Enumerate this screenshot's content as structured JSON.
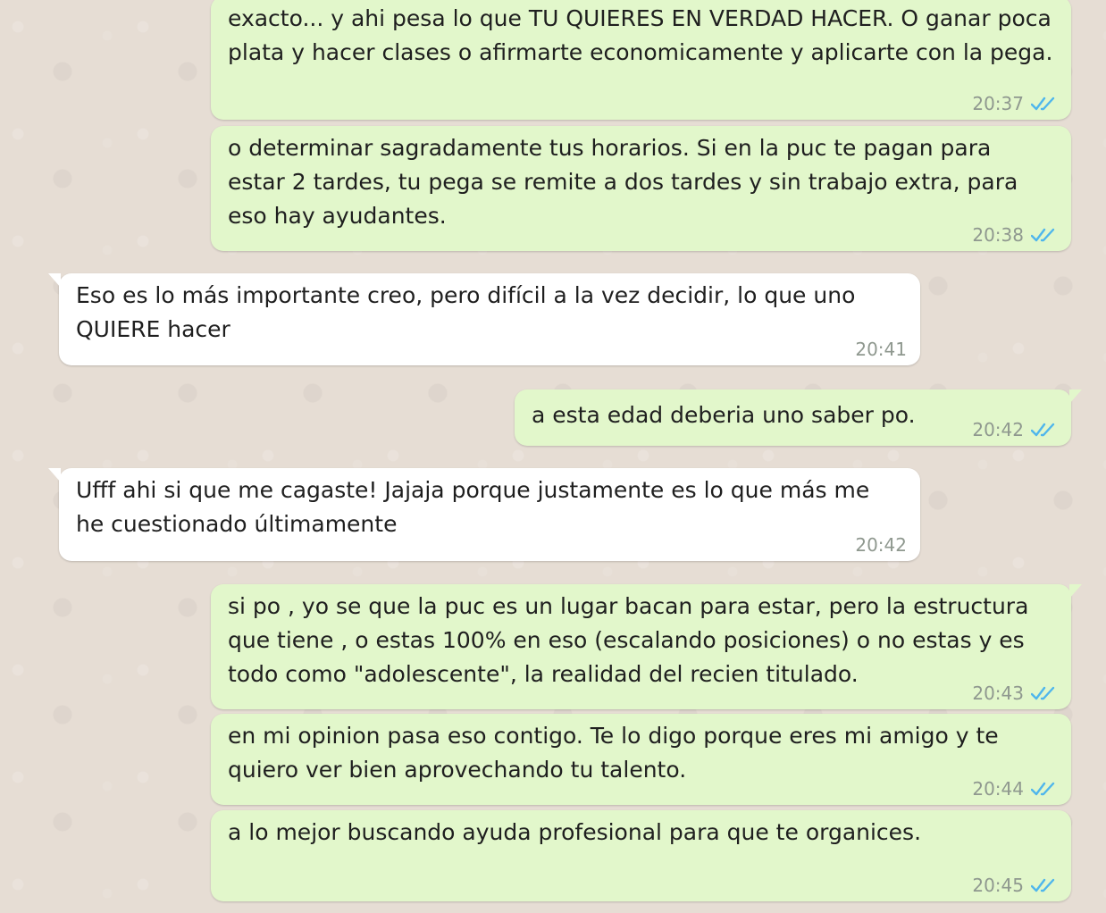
{
  "messages": [
    {
      "direction": "outgoing",
      "text": "exacto... y ahi pesa lo que TU QUIERES EN VERDAD HACER. O ganar poca plata y hacer clases o afirmarte economicamente y aplicarte con la pega.",
      "time": "20:37",
      "status_icon": "double-check-read"
    },
    {
      "direction": "outgoing",
      "text": "o determinar sagradamente tus horarios. Si en la puc te pagan para estar 2 tardes, tu pega se remite a dos tardes y sin trabajo extra, para eso hay ayudantes.",
      "time": "20:38",
      "status_icon": "double-check-read"
    },
    {
      "direction": "incoming",
      "text": "Eso es lo más importante creo, pero difícil a la vez decidir, lo que uno QUIERE hacer",
      "time": "20:41"
    },
    {
      "direction": "outgoing",
      "text": "a esta edad deberia uno saber po.",
      "time": "20:42",
      "status_icon": "double-check-read"
    },
    {
      "direction": "incoming",
      "text": "Ufff ahi si que me cagaste! Jajaja porque justamente es lo que más me he cuestionado últimamente",
      "time": "20:42"
    },
    {
      "direction": "outgoing",
      "text": "si po , yo se que la puc es un lugar bacan para estar, pero la estructura que tiene , o estas 100% en eso (escalando posiciones) o no estas y es todo como \"adolescente\", la realidad del recien titulado.",
      "time": "20:43",
      "status_icon": "double-check-read"
    },
    {
      "direction": "outgoing",
      "text": "en mi opinion pasa eso contigo. Te lo digo porque eres mi amigo y te quiero ver bien aprovechando tu talento.",
      "time": "20:44",
      "status_icon": "double-check-read"
    },
    {
      "direction": "outgoing",
      "text": "a lo mejor buscando ayuda profesional para que te organices.",
      "time": "20:45",
      "status_icon": "double-check-read"
    }
  ],
  "colors": {
    "background": "#e6ddd4",
    "outgoing_bubble": "#e2f7cb",
    "incoming_bubble": "#ffffff",
    "read_receipt": "#4fb6ec",
    "meta_text": "#8f988f"
  }
}
